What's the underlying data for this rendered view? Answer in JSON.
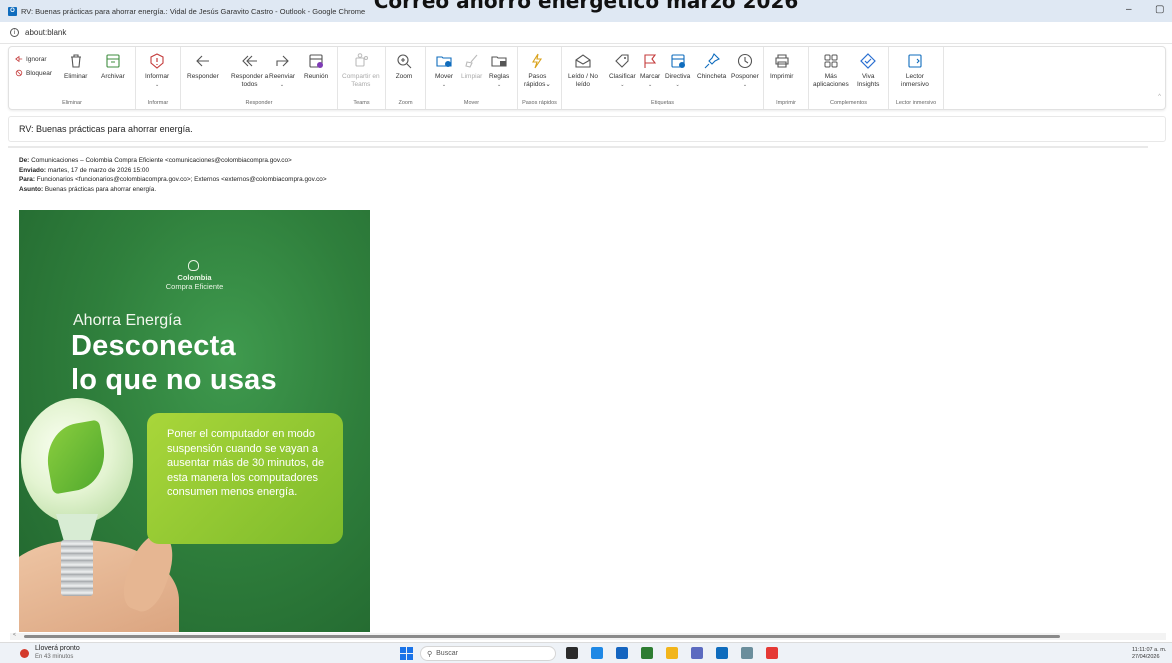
{
  "overlay_title": "Correo ahorro energético marzo 2026",
  "window": {
    "title": "RV: Buenas prácticas para ahorrar energía.: Vidal de Jesús Garavito Castro - Outlook - Google Chrome",
    "minimize": "–",
    "maximize": "▢"
  },
  "address": {
    "url": "about:blank",
    "info_icon": "info-icon"
  },
  "ribbon": {
    "groups": {
      "eliminar": "Eliminar",
      "informar": "Informar",
      "responder": "Responder",
      "teams": "Teams",
      "zoom": "Zoom",
      "mover": "Mover",
      "pasos": "Pasos rápidos",
      "etiquetas": "Etiquetas",
      "imprimir": "Imprimir",
      "complementos": "Complementos",
      "lector": "Lector inmersivo"
    },
    "buttons": {
      "ignorar": "Ignorar",
      "bloquear": "Bloquear",
      "eliminar": "Eliminar",
      "archivar": "Archivar",
      "informar": "Informar",
      "responder": "Responder",
      "responder_todos_1": "Responder a",
      "responder_todos_2": "todos",
      "reenviar": "Reenviar",
      "reunion": "Reunión",
      "compartir_1": "Compartir en",
      "compartir_2": "Teams",
      "zoom": "Zoom",
      "mover": "Mover",
      "limpiar": "Limpiar",
      "reglas": "Reglas",
      "pasos_1": "Pasos",
      "pasos_2": "rápidos",
      "leido_1": "Leído / No",
      "leido_2": "leído",
      "clasificar": "Clasificar",
      "marcar": "Marcar",
      "directiva": "Directiva",
      "chincheta": "Chincheta",
      "posponer": "Posponer",
      "imprimir": "Imprimir",
      "mas_1": "Más",
      "mas_2": "aplicaciones",
      "viva_1": "Viva",
      "viva_2": "Insights",
      "lector_1": "Lector",
      "lector_2": "inmersivo"
    }
  },
  "message": {
    "subject": "RV: Buenas prácticas para ahorrar energía.",
    "from_label": "De:",
    "from": "Comunicaciones – Colombia Compra Eficiente <comunicaciones@colombiacompra.gov.co>",
    "sent_label": "Enviado:",
    "sent": "martes, 17 de marzo de 2026 15:00",
    "to_label": "Para:",
    "to": "Funcionarios <funcionarios@colombiacompra.gov.co>; Externos <externos@colombiacompra.gov.co>",
    "subject_label": "Asunto:",
    "subject_field": "Buenas prácticas para ahorrar energía."
  },
  "poster": {
    "logo_line1": "Colombia",
    "logo_line2": "Compra Eficiente",
    "kicker": "Ahorra Energía",
    "headline1": "Desconecta",
    "headline2": "lo que no usas",
    "tip": "Poner el computador en modo suspensión cuando se vayan a ausentar más de 30 minutos, de esta manera los computadores consumen menos energía."
  },
  "taskbar": {
    "weather_line1": "Lloverá pronto",
    "weather_line2": "En 43 minutos",
    "search": "Buscar",
    "clock_time": "11:11:07 a. m.",
    "clock_date": "27/04/2026",
    "app_colors": [
      "#2b2b2b",
      "#1e88e5",
      "#1565c0",
      "#2e7d32",
      "#f2b51b",
      "#5c6bc0",
      "#0f6cbd",
      "#6b8e9c",
      "#e53935"
    ]
  }
}
